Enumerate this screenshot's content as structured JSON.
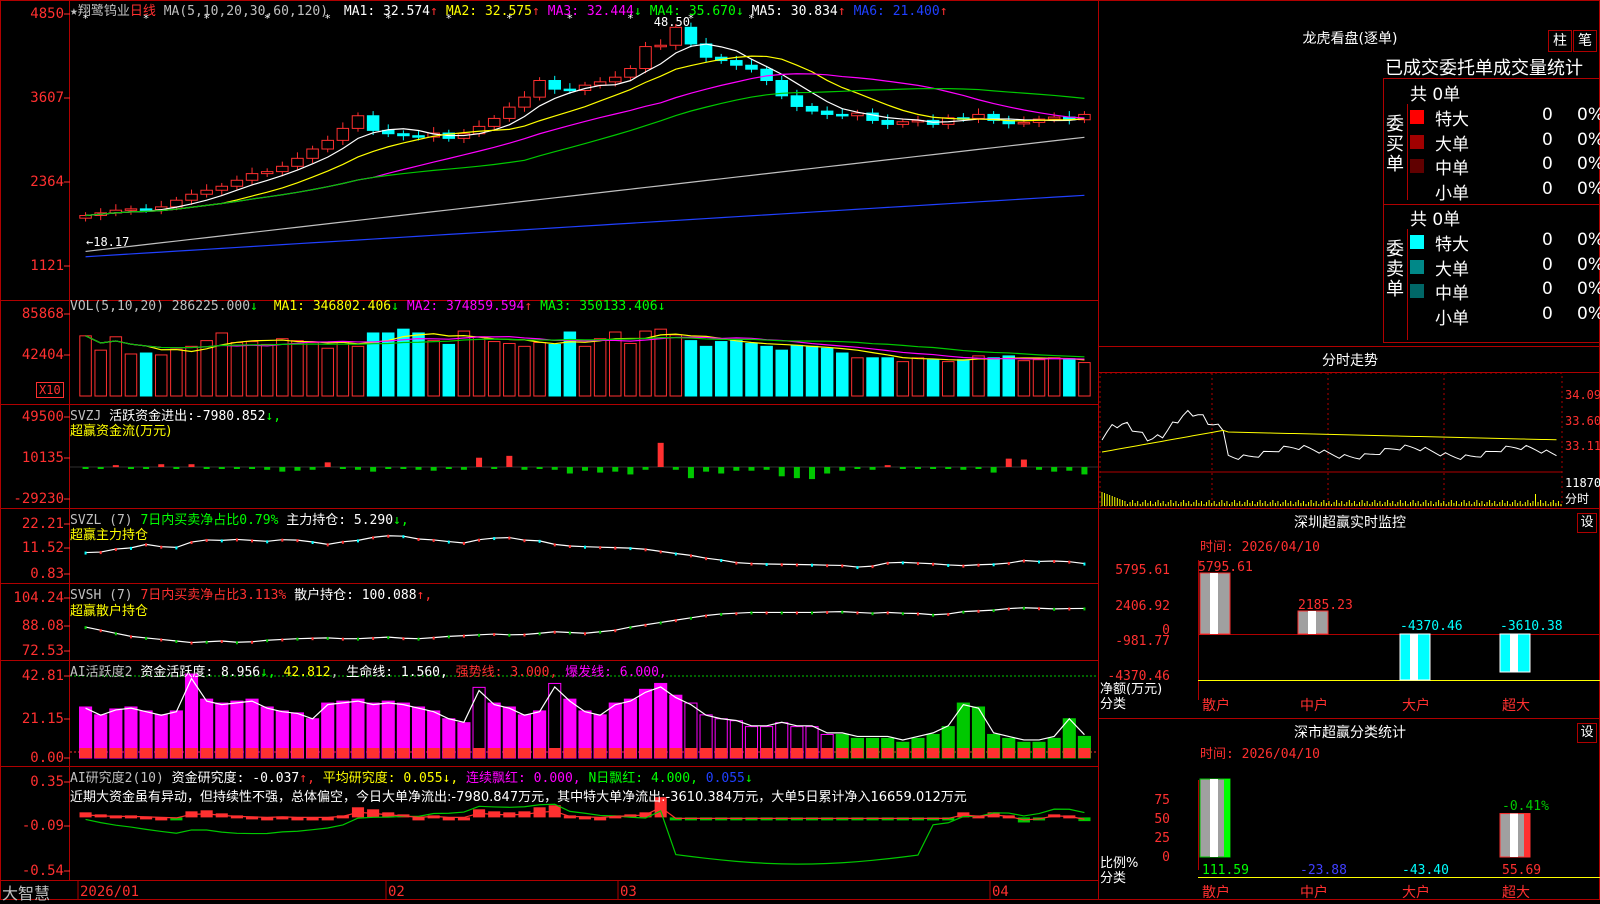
{
  "colors": {
    "up": "#ff3030",
    "down": "#00ffff",
    "frame": "#b00000",
    "yellow": "#ffff00",
    "magenta": "#ff00ff",
    "green": "#00c800",
    "blue": "#2040ff",
    "white": "#ffffff"
  },
  "brand": "大智慧",
  "main_panel": {
    "title_star": "★",
    "title": "翔鹭钨业",
    "period": "日线",
    "ma_params": "MA(5,10,20,30,60,120)",
    "mas": [
      {
        "label": "MA1:",
        "value": "32.574",
        "dir": "↑",
        "color": "#ffffff"
      },
      {
        "label": "MA2:",
        "value": "32.575",
        "dir": "↑",
        "color": "#ffff00"
      },
      {
        "label": "MA3:",
        "value": "32.444",
        "dir": "↓",
        "color": "#ff00ff"
      },
      {
        "label": "MA4:",
        "value": "35.670",
        "dir": "↓",
        "color": "#00ff00"
      },
      {
        "label": "MA5:",
        "value": "30.834",
        "dir": "↑",
        "color": "#ffffff"
      },
      {
        "label": "MA6:",
        "value": "21.400",
        "dir": "↑",
        "color": "#2040ff"
      }
    ],
    "y_ticks": [
      "4850",
      "3607",
      "2364",
      "1121"
    ],
    "high_label": "48.50",
    "low_label": "18.17"
  },
  "vol_panel": {
    "header": "VOL(5,10,20)",
    "value": "286225.000",
    "value_dir": "↓",
    "mas": [
      {
        "label": "MA1:",
        "value": "346802.406",
        "dir": "↓",
        "color": "#ffff00"
      },
      {
        "label": "MA2:",
        "value": "374859.594",
        "dir": "↑",
        "color": "#ff00ff"
      },
      {
        "label": "MA3:",
        "value": "350133.406",
        "dir": "↓",
        "color": "#00ff00"
      }
    ],
    "y_ticks": [
      "85868",
      "42404"
    ],
    "unit": "X10"
  },
  "svzj_panel": {
    "name": "SVZJ",
    "label": "活跃资金进出:",
    "value": "-7980.852",
    "dir": "↓,",
    "subtitle": "超赢资金流(万元)",
    "y_ticks": [
      "49500",
      "10135",
      "-29230"
    ]
  },
  "svzl_panel": {
    "name": "SVZL",
    "param": "(7)",
    "text1": "7日内买卖净占比0.79%",
    "text2": "主力持仓:",
    "value": "5.290",
    "dir": "↓,",
    "subtitle": "超赢主力持仓",
    "y_ticks": [
      "22.21",
      "11.52",
      "0.83"
    ]
  },
  "svsh_panel": {
    "name": "SVSH",
    "param": "(7)",
    "text1": "7日内买卖净占比3.113%",
    "text2": "散户持仓:",
    "value": "100.088",
    "dir": "↑,",
    "subtitle": "超赢散户持仓",
    "y_ticks": [
      "104.24",
      "88.08",
      "72.53"
    ]
  },
  "ai_active_panel": {
    "name": "AI活跃度2",
    "label": "资金活跃度:",
    "value": "8.956",
    "dir": "↓,",
    "v2": "42.812",
    "lifeline_label": "生命线:",
    "lifeline": "1.560,",
    "strong_label": "强势线:",
    "strong": "3.000,",
    "burst_label": "爆发线:",
    "burst": "6.000,",
    "y_ticks": [
      "42.81",
      "21.15",
      "0.00"
    ]
  },
  "ai_research_panel": {
    "name": "AI研究度2(10)",
    "label": "资金研究度:",
    "value": "-0.037",
    "dir": "↑,",
    "avg_label": "平均研究度:",
    "avg": "0.055",
    "avg_dir": "↓,",
    "cont_label": "连续飘红:",
    "cont": "0.000,",
    "n_label": "N日飘红:",
    "n": "4.000,",
    "last": "0.055",
    "last_dir": "↓",
    "comment": "近期大资金虽有异动，但持续性不强，总体偏空，今日大单净流出:-7980.847万元，其中特大单净流出:-3610.384万元，大单5日累计净入16659.012万元",
    "y_ticks": [
      "0.35",
      "-0.09",
      "-0.54"
    ]
  },
  "date_axis": [
    "2026/01",
    "02",
    "03",
    "04"
  ],
  "right": {
    "dragon_title": "龙虎看盘(逐单)",
    "btn1": "柱",
    "btn2": "笔",
    "stat_title": "已成交委托单成交量统计",
    "buy_side": "委买单",
    "sell_side": "委卖单",
    "buy_total": "共 0单",
    "sell_total": "共 0单",
    "buy_rows": [
      {
        "name": "特大",
        "count": "0",
        "pct": "0%",
        "color": "#ff0000"
      },
      {
        "name": "大单",
        "count": "0",
        "pct": "0%",
        "color": "#a00000"
      },
      {
        "name": "中单",
        "count": "0",
        "pct": "0%",
        "color": "#600000"
      },
      {
        "name": "小单",
        "count": "0",
        "pct": "0%",
        "color": "#000000"
      }
    ],
    "sell_rows": [
      {
        "name": "特大",
        "count": "0",
        "pct": "0%",
        "color": "#00ffff"
      },
      {
        "name": "大单",
        "count": "0",
        "pct": "0%",
        "color": "#008888"
      },
      {
        "name": "中单",
        "count": "0",
        "pct": "0%",
        "color": "#006666"
      },
      {
        "name": "小单",
        "count": "0",
        "pct": "0%",
        "color": "#000000"
      }
    ],
    "intraday_title": "分时走势",
    "intraday_prices": [
      "34.09",
      "33.60",
      "33.11"
    ],
    "intraday_vol": "11870",
    "intraday_unit": "分时",
    "monitor_title": "深圳超赢实时监控",
    "settings_label": "设",
    "monitor_time": "时间: 2026/04/10",
    "monitor_y": [
      "5795.61",
      "2406.92",
      "0",
      "-981.77",
      "-4370.46"
    ],
    "monitor_unit1": "净额(万元)",
    "monitor_unit2": "分类",
    "monitor_bars": [
      {
        "cat": "散户",
        "value": "5795.61",
        "color": "#ff3030"
      },
      {
        "cat": "中户",
        "value": "2185.23",
        "color": "#ff3030"
      },
      {
        "cat": "大户",
        "value": "-4370.46",
        "color": "#00ffff"
      },
      {
        "cat": "超大",
        "value": "-3610.38",
        "color": "#00ffff"
      }
    ],
    "class_title": "深市超赢分类统计",
    "class_time": "时间: 2026/04/10",
    "class_y": [
      "75",
      "50",
      "25",
      "0"
    ],
    "class_unit1": "比例%",
    "class_unit2": "分类",
    "class_bars": [
      {
        "cat": "散户",
        "value": "111.59",
        "color": "#00ff00"
      },
      {
        "cat": "中户",
        "value": "-23.88",
        "color": "#4040ff"
      },
      {
        "cat": "大户",
        "value": "-43.40",
        "color": "#00ffff"
      },
      {
        "cat": "超大",
        "value": "55.69",
        "color": "#ff3030"
      }
    ],
    "class_extra": "-0.41%"
  },
  "chart_data": [
    {
      "type": "candlestick",
      "title": "翔鹭钨业 日线",
      "ylim": [
        11.21,
        48.5
      ],
      "high": 48.5,
      "low": 18.17,
      "closes": [
        18.2,
        18.6,
        19.0,
        19.2,
        19.1,
        19.5,
        20.5,
        21.4,
        22.0,
        22.6,
        23.5,
        24.5,
        24.8,
        25.6,
        26.8,
        28.2,
        29.5,
        31.3,
        33.2,
        31.0,
        30.5,
        30.2,
        30.0,
        30.6,
        29.8,
        30.5,
        31.6,
        32.8,
        34.5,
        36.0,
        38.5,
        37.2,
        37.0,
        37.8,
        38.3,
        39.0,
        40.3,
        43.6,
        43.8,
        46.5,
        44.0,
        42.0,
        41.5,
        40.8,
        40.2,
        38.5,
        36.2,
        34.6,
        33.9,
        33.4,
        33.2,
        33.6,
        32.5,
        31.9,
        32.3,
        32.5,
        31.9,
        32.9,
        32.8,
        33.4,
        32.5,
        32.0,
        32.2,
        32.7,
        33.0,
        32.6,
        33.4
      ]
    },
    {
      "type": "bar",
      "title": "VOL",
      "ylim": [
        0,
        85868
      ],
      "values": [
        63000,
        48000,
        62000,
        44000,
        45000,
        43000,
        49000,
        52000,
        58000,
        66000,
        56000,
        57000,
        54000,
        60000,
        58000,
        56000,
        50000,
        57000,
        52000,
        66000,
        66000,
        70000,
        66000,
        58000,
        54000,
        68000,
        62000,
        57000,
        55000,
        52000,
        56000,
        54000,
        67000,
        52000,
        60000,
        67000,
        55000,
        68000,
        70000,
        64000,
        58000,
        52000,
        57000,
        58000,
        55000,
        52000,
        48000,
        53000,
        52000,
        50000,
        45000,
        40000,
        40000,
        40000,
        36000,
        40000,
        38000,
        36000,
        38000,
        42000,
        40000,
        42000,
        37000,
        38000,
        40000,
        39000,
        35000
      ]
    },
    {
      "type": "bar",
      "title": "SVZJ 超赢资金流(万元)",
      "ylim": [
        -29230,
        49500
      ],
      "values": [
        -2000,
        -1500,
        2000,
        -1000,
        -2000,
        3000,
        -1000,
        3000,
        -2000,
        -1500,
        -1000,
        -2000,
        -3000,
        -5000,
        -4000,
        -3000,
        5000,
        -2000,
        -3000,
        -5000,
        -1000,
        -2000,
        -3000,
        -4000,
        -1000,
        -3000,
        10000,
        -2000,
        12000,
        -3000,
        -1000,
        -3000,
        -7000,
        -4000,
        -6000,
        -5000,
        -8000,
        -3000,
        26000,
        -3000,
        -12000,
        -5000,
        -7000,
        -4000,
        -4000,
        -3000,
        -10000,
        -12000,
        -13000,
        -7000,
        -4000,
        -2000,
        -3000,
        2000,
        -1500,
        -2000,
        -1500,
        -2000,
        -3000,
        -2000,
        -6000,
        9000,
        8000,
        -3000,
        -5000,
        -4000,
        -7980
      ]
    },
    {
      "type": "line",
      "title": "SVZL 超赢主力持仓",
      "ylim": [
        0.83,
        22.21
      ],
      "values": [
        10,
        10.2,
        11.5,
        12,
        13.5,
        12.5,
        12.2,
        14.5,
        15.4,
        15.2,
        15.6,
        15.2,
        14.8,
        15.5,
        15.3,
        14.5,
        13.5,
        14.6,
        15.2,
        16.5,
        17.2,
        17.0,
        15.8,
        15.4,
        14.7,
        14.1,
        15.5,
        16.2,
        16.4,
        15.3,
        15.0,
        13.5,
        12.8,
        12.5,
        12.3,
        12.1,
        11.9,
        11.4,
        10.5,
        9.6,
        8.8,
        7.6,
        6.8,
        5.7,
        5.3,
        5.1,
        5.0,
        4.9,
        4.8,
        4.6,
        4.5,
        3.8,
        4.2,
        5.6,
        5.8,
        5.5,
        5.2,
        4.7,
        4.4,
        4.8,
        5.0,
        5.5,
        6.6,
        6.2,
        6.4,
        6.1,
        5.3
      ]
    },
    {
      "type": "line",
      "title": "SVSH 超赢散户持仓",
      "ylim": [
        72.53,
        104.24
      ],
      "values": [
        88,
        86,
        84,
        82,
        81,
        80,
        79,
        78,
        78.5,
        79,
        78.2,
        78.5,
        79.5,
        80,
        80.5,
        80.8,
        81,
        80.5,
        80.5,
        81,
        81.5,
        80.8,
        80.5,
        81.2,
        82,
        82.5,
        83,
        83.5,
        83,
        83.2,
        84,
        85,
        84.5,
        84,
        85,
        86,
        88,
        89.5,
        91,
        92.5,
        94,
        95.5,
        96.5,
        97,
        97.5,
        97.5,
        97.5,
        97.5,
        97.5,
        97.8,
        98,
        97.5,
        97,
        97.5,
        97,
        96.8,
        96,
        96.5,
        98,
        98.5,
        99,
        100,
        100.5,
        100.2,
        99.8,
        100,
        100.088
      ]
    },
    {
      "type": "bar",
      "title": "AI活跃度2",
      "ylim": [
        0,
        42.81
      ],
      "values": [
        26,
        22,
        25,
        26,
        24,
        22,
        24,
        42.8,
        30,
        28,
        29,
        30,
        26,
        24,
        23,
        20,
        28,
        29,
        30,
        28,
        29,
        28,
        26,
        24,
        20,
        18,
        36,
        28,
        26,
        22,
        24,
        38,
        30,
        24,
        22,
        28,
        30,
        35,
        38,
        32,
        28,
        22,
        20,
        19,
        16,
        16,
        18,
        16,
        16,
        12,
        12,
        10,
        10,
        10,
        8,
        10,
        12,
        16,
        28,
        26,
        12,
        10,
        8,
        8,
        10,
        20,
        11
      ]
    },
    {
      "type": "bar",
      "title": "AI研究度2(10)",
      "ylim": [
        -0.54,
        0.35
      ],
      "values": [
        0.05,
        0.03,
        0.02,
        0.02,
        0.01,
        0.0,
        -0.01,
        0.06,
        0.07,
        0.04,
        0.02,
        0.01,
        0.0,
        0.01,
        0.0,
        0.0,
        0.0,
        0.02,
        0.1,
        0.08,
        0.05,
        0.03,
        0.0,
        0.02,
        0.0,
        0.0,
        0.08,
        0.06,
        0.05,
        0.06,
        0.1,
        0.12,
        0.02,
        0.01,
        0.0,
        0.02,
        0.03,
        0.05,
        0.2,
        -0.02,
        -0.02,
        -0.02,
        -0.02,
        -0.02,
        -0.02,
        -0.02,
        -0.02,
        -0.02,
        -0.02,
        -0.02,
        -0.02,
        -0.02,
        -0.02,
        -0.02,
        -0.02,
        -0.02,
        -0.02,
        -0.02,
        0.05,
        0.02,
        0.05,
        0.02,
        -0.05,
        -0.03,
        0.03,
        0.02,
        -0.037
      ]
    }
  ]
}
